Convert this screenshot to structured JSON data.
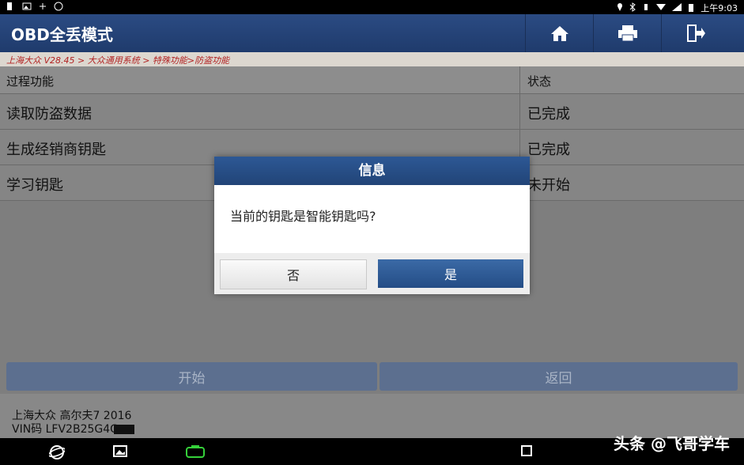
{
  "status_bar": {
    "time": "上午9:03"
  },
  "header": {
    "title": "OBD全丢模式"
  },
  "breadcrumb": "上海大众 V28.45 > 大众通用系统 > 特殊功能>防盗功能",
  "table": {
    "headers": [
      "过程功能",
      "状态"
    ],
    "rows": [
      {
        "function": "读取防盗数据",
        "status": "已完成"
      },
      {
        "function": "生成经销商钥匙",
        "status": "已完成"
      },
      {
        "function": "学习钥匙",
        "status": "未开始"
      }
    ]
  },
  "buttons": {
    "start": "开始",
    "back": "返回"
  },
  "vehicle": {
    "model": "上海大众 高尔夫7 2016",
    "vin": "VIN码 LFV2B25G4G"
  },
  "dialog": {
    "title": "信息",
    "message": "当前的钥匙是智能钥匙吗?",
    "no": "否",
    "yes": "是"
  },
  "watermark": "头条 @飞哥学车",
  "icons": [
    "home-icon",
    "print-icon",
    "exit-icon",
    "back-nav-icon",
    "gallery-icon",
    "vci-icon",
    "recent-apps-icon"
  ]
}
